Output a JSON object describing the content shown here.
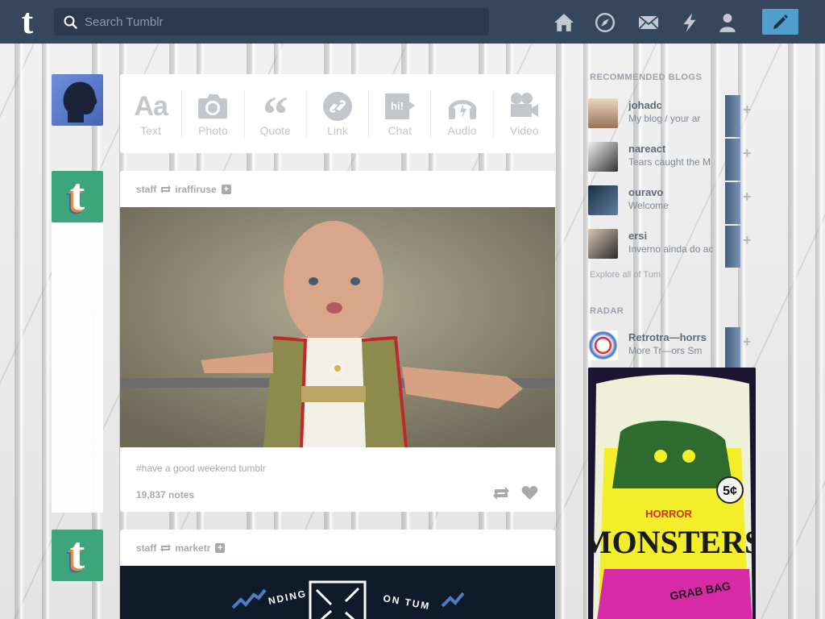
{
  "header": {
    "search_placeholder": "Search Tumblr",
    "logo": "t",
    "nav_icons": [
      "home-icon",
      "explore-icon",
      "inbox-icon",
      "activity-icon",
      "account-icon"
    ],
    "compose_icon": "pencil-icon"
  },
  "post_types": [
    {
      "label": "Text",
      "icon": "text-icon"
    },
    {
      "label": "Photo",
      "icon": "camera-icon"
    },
    {
      "label": "Quote",
      "icon": "quote-icon"
    },
    {
      "label": "Link",
      "icon": "link-icon"
    },
    {
      "label": "Chat",
      "icon": "chat-icon"
    },
    {
      "label": "Audio",
      "icon": "headphones-icon"
    },
    {
      "label": "Video",
      "icon": "video-camera-icon"
    }
  ],
  "chat_glyph": "hi!",
  "posts": [
    {
      "author": "staff",
      "reblogged_from": "iraffiruse",
      "tags": "#have a good weekend tumblr",
      "notes": "19,837 notes"
    },
    {
      "author": "staff",
      "reblogged_from": "marketr",
      "banner_left": "NDING",
      "banner_right": "ON TUM"
    }
  ],
  "sidebar": {
    "recommended_heading": "RECOMMENDED BLOGS",
    "recommended": [
      {
        "name": "johadc",
        "desc": "My blog / your ar"
      },
      {
        "name": "nareact",
        "desc": "Tears caught the M"
      },
      {
        "name": "ouravo",
        "desc": "Welcome"
      },
      {
        "name": "ersi",
        "desc": "Inverno ainda do ac"
      }
    ],
    "explore_link": "Explore all of Tum",
    "radar_heading": "RADAR",
    "radar": {
      "name": "Retrotra—horrs",
      "desc": "More Tr—ors Sm"
    },
    "radar_card": {
      "price": "5¢",
      "line1": "HORROR",
      "line2": "MONSTERS",
      "line3": "GRAB BAG"
    }
  },
  "colors": {
    "header_bg": "#36465d",
    "compose_bg": "#529ecc",
    "avatar_green": "#3da57b"
  }
}
